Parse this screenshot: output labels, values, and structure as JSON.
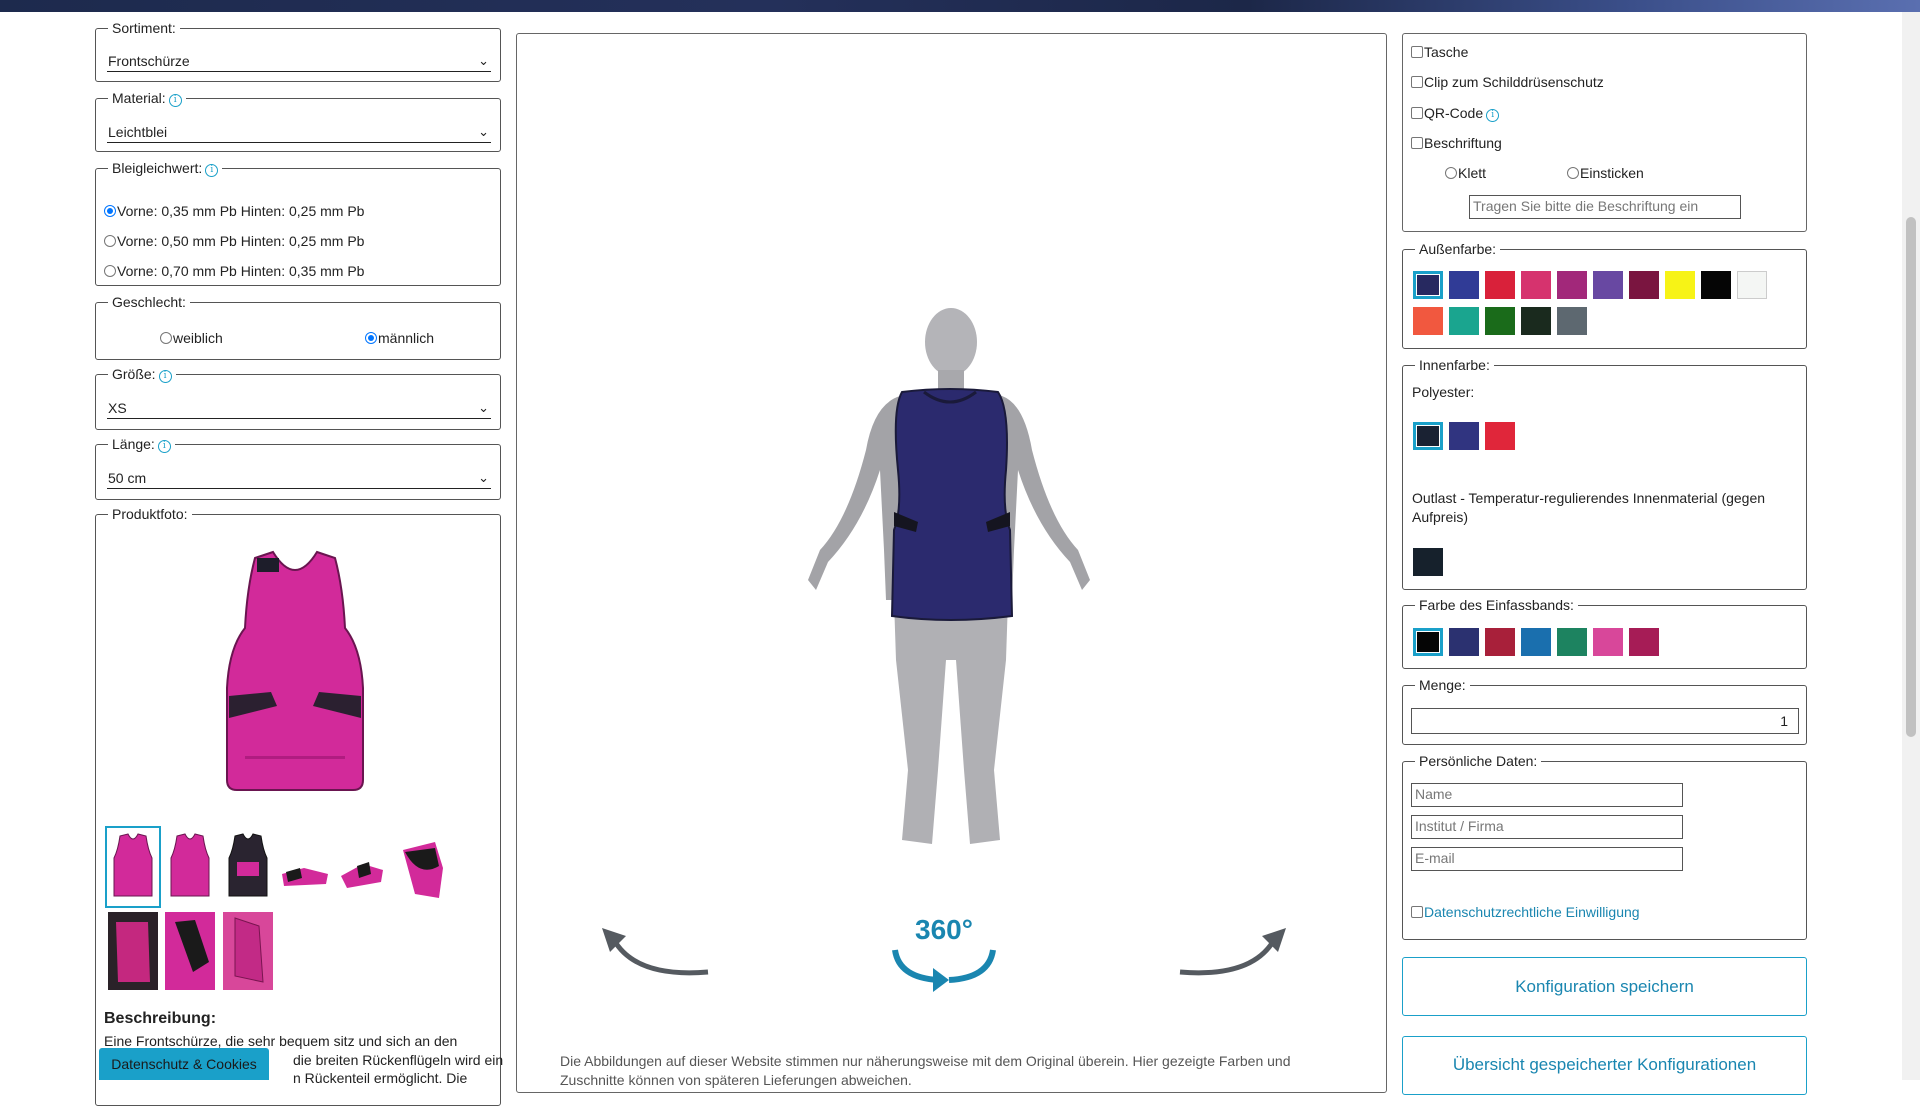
{
  "left": {
    "sortiment": {
      "legend": "Sortiment:",
      "value": "Frontschürze"
    },
    "material": {
      "legend": "Material:",
      "value": "Leichtblei"
    },
    "bleigleichwert": {
      "legend": "Bleigleichwert:",
      "options": [
        "Vorne: 0,35 mm Pb Hinten: 0,25 mm Pb",
        "Vorne: 0,50 mm Pb Hinten: 0,25 mm Pb",
        "Vorne: 0,70 mm Pb Hinten: 0,35 mm Pb"
      ],
      "selected": 0
    },
    "geschlecht": {
      "legend": "Geschlecht:",
      "options": [
        "weiblich",
        "männlich"
      ],
      "selected": 1
    },
    "groesse": {
      "legend": "Größe:",
      "value": "XS"
    },
    "laenge": {
      "legend": "Länge:",
      "value": "50 cm"
    },
    "produktfoto": {
      "legend": "Produktfoto:"
    },
    "beschreibung": {
      "heading": "Beschreibung:",
      "line1": "Eine Frontschürze, die sehr bequem sitz und sich an den",
      "line2": "die breiten Rückenflügeln wird ein",
      "line3": "n Rückenteil ermöglicht. Die"
    },
    "cookie_label": "Datenschutz & Cookies"
  },
  "center": {
    "disclaimer_line1": "Die Abbildungen auf dieser Website stimmen nur näherungsweise mit dem Original überein. Hier gezeigte Farben und",
    "disclaimer_line2": "Zuschnitte können von späteren Lieferungen abweichen.",
    "rotate_label": "360°",
    "garment_color": "#2b2a6e"
  },
  "right": {
    "options": {
      "tasche": "Tasche",
      "clip": "Clip zum Schilddrüsenschutz",
      "qr": "QR-Code",
      "beschriftung": "Beschriftung",
      "klett": "Klett",
      "einsticken": "Einsticken",
      "beschriftung_placeholder": "Tragen Sie bitte die Beschriftung ein"
    },
    "aussenfarbe": {
      "legend": "Außenfarbe:",
      "colors": [
        "#272960",
        "#303b96",
        "#d9213a",
        "#d6336e",
        "#a2287a",
        "#6848a2",
        "#7a1540",
        "#f7f316",
        "#050505",
        "#f4f6f4",
        "#f1583f",
        "#1aa58f",
        "#1a6b1a",
        "#1a2a1e",
        "#5d6870"
      ],
      "selected": 0
    },
    "innenfarbe": {
      "legend": "Innenfarbe:",
      "polyester_label": "Polyester:",
      "polyester_colors": [
        "#1a2233",
        "#303480",
        "#e0263a"
      ],
      "selected": 0,
      "outlast_label": "Outlast - Temperatur-regulierendes Innenmaterial (gegen",
      "outlast_label2": "Aufpreis)",
      "outlast_colors": [
        "#16212c"
      ]
    },
    "einfassband": {
      "legend": "Farbe des Einfassbands:",
      "colors": [
        "#050505",
        "#2b3170",
        "#a8203a",
        "#1a6fae",
        "#1d8360",
        "#d8479a",
        "#a61c56"
      ],
      "selected": 0
    },
    "menge": {
      "legend": "Menge:",
      "value": "1"
    },
    "persoenlich": {
      "legend": "Persönliche Daten:",
      "name_ph": "Name",
      "firma_ph": "Institut / Firma",
      "email_ph": "E-mail",
      "consent": "Datenschutzrechtliche Einwilligung"
    },
    "save_button": "Konfiguration speichern",
    "overview_button": "Übersicht gespeicherter Konfigurationen"
  }
}
